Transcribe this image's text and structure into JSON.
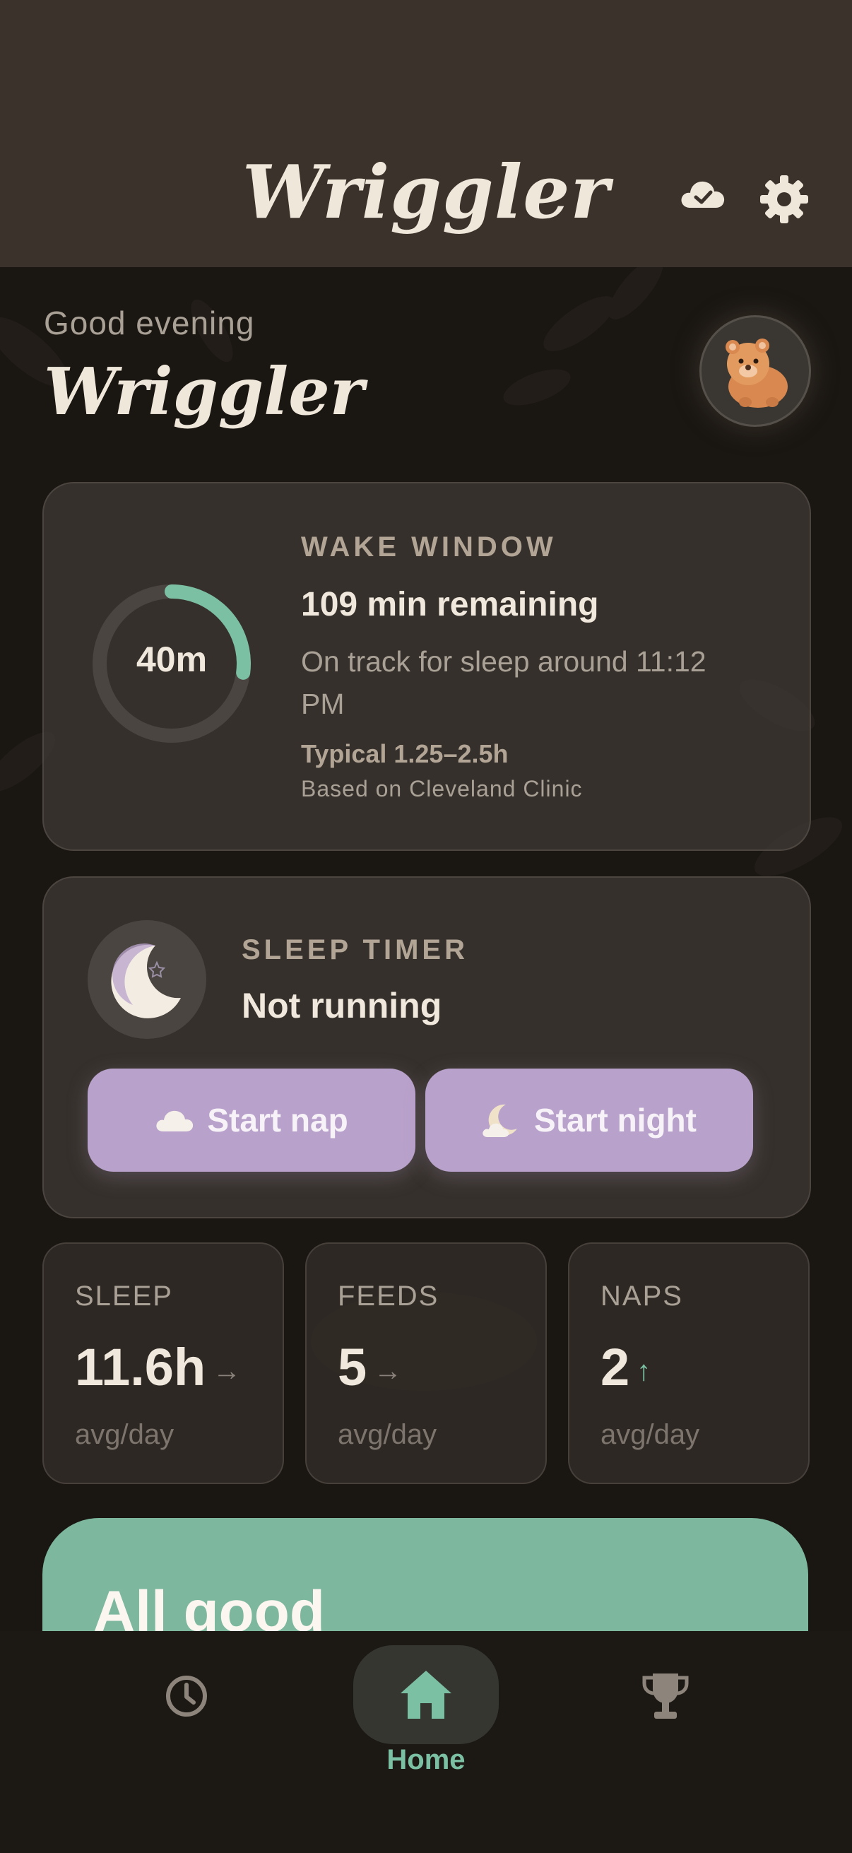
{
  "header": {
    "title": "Wriggler",
    "icons": [
      "cloud-check-icon",
      "gear-icon"
    ]
  },
  "greeting": {
    "salutation": "Good evening",
    "baby_name": "Wriggler"
  },
  "wake_window": {
    "title": "WAKE WINDOW",
    "elapsed": "40m",
    "elapsed_fraction": 0.27,
    "remaining": "109 min remaining",
    "forecast": "On track for sleep around 11:12 PM",
    "typical": "Typical 1.25–2.5h",
    "source": "Based on Cleveland Clinic"
  },
  "sleep_timer": {
    "title": "SLEEP TIMER",
    "status": "Not running",
    "nap_button": "Start nap",
    "night_button": "Start night"
  },
  "stats": [
    {
      "label": "SLEEP",
      "value": "11.6h",
      "trend": "→",
      "sub": "avg/day"
    },
    {
      "label": "FEEDS",
      "value": "5",
      "trend": "→",
      "sub": "avg/day"
    },
    {
      "label": "NAPS",
      "value": "2",
      "trend": "↑",
      "sub": "avg/day"
    }
  ],
  "status_card": {
    "text": "All good"
  },
  "nav": {
    "home_label": "Home",
    "items": [
      "history-icon",
      "home-icon",
      "trophy-icon"
    ]
  },
  "colors": {
    "accent_green": "#7cc0a3",
    "button_purple": "#b8a1ca",
    "header_bg": "#3a322b",
    "page_bg": "#1a1612"
  }
}
